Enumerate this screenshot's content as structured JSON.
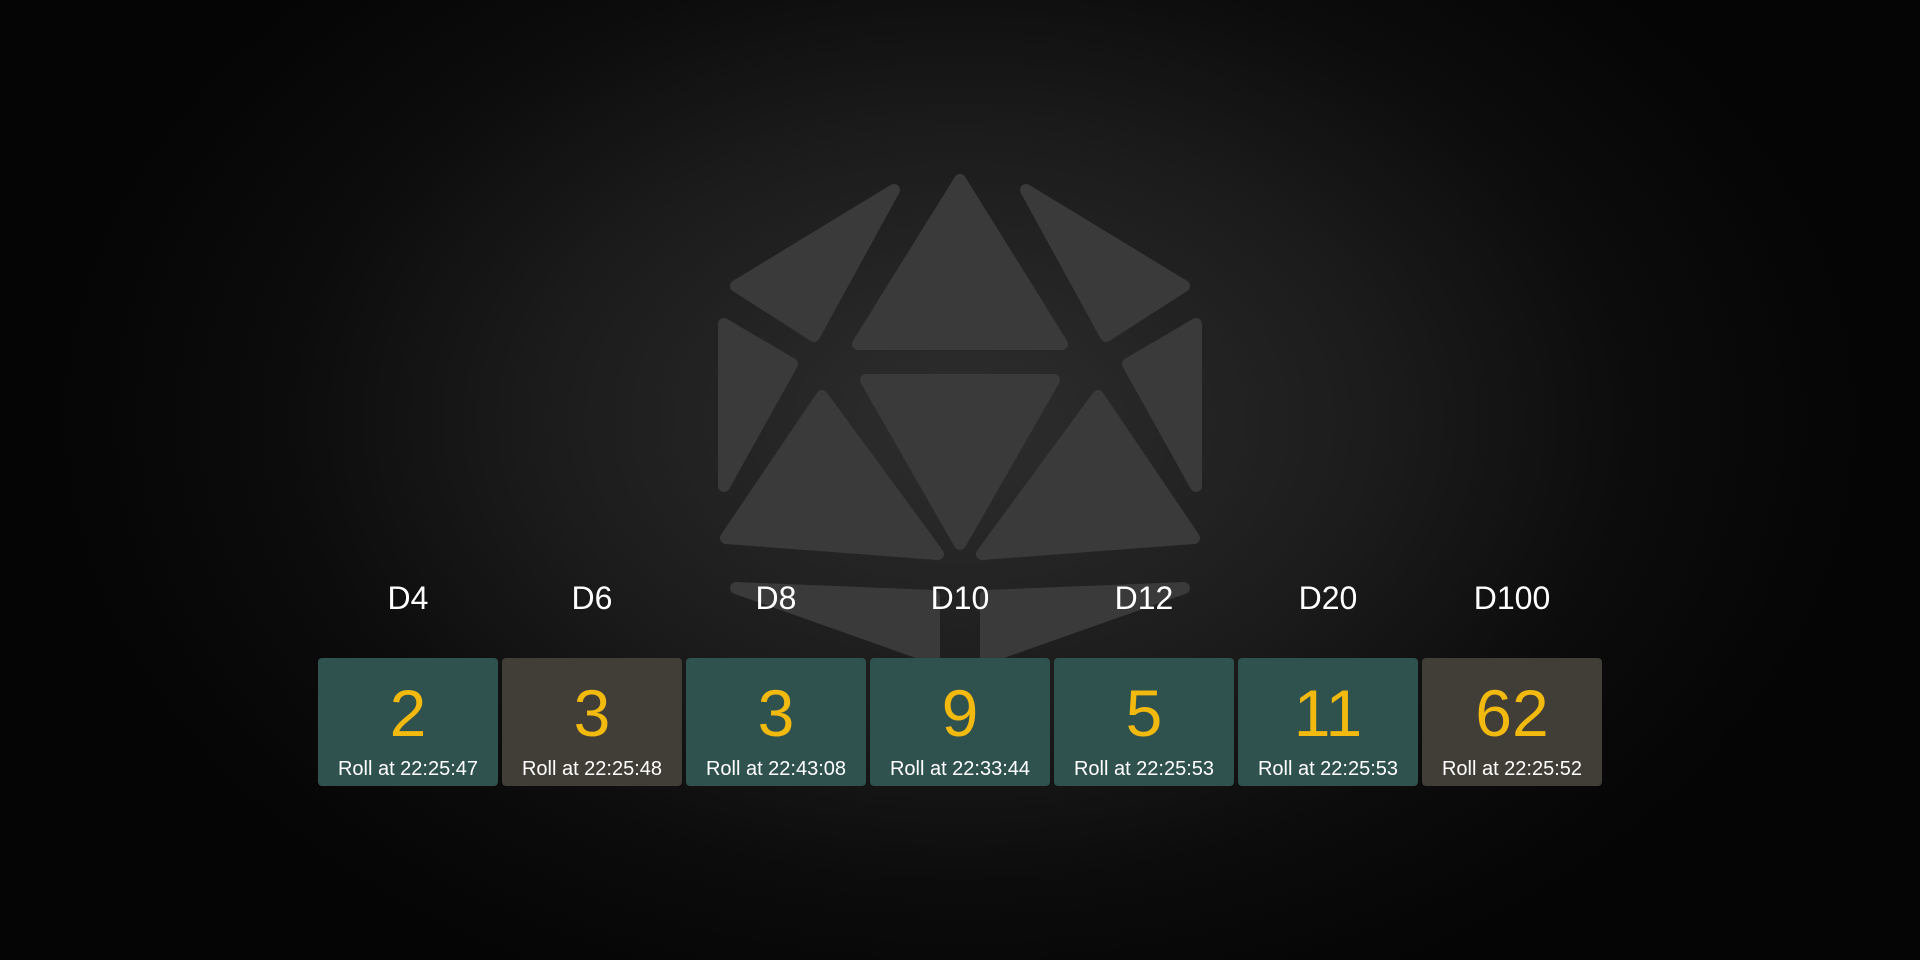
{
  "logo": {
    "icon": "d20-icon"
  },
  "colors": {
    "accent": "#f2b90f",
    "card_teal": "#30524e",
    "card_brown": "#413d37",
    "text": "#ffffff"
  },
  "dice": [
    {
      "label": "D4",
      "value": "2",
      "time": "Roll at 22:25:47",
      "color": "#30524e"
    },
    {
      "label": "D6",
      "value": "3",
      "time": "Roll at 22:25:48",
      "color": "#413d37"
    },
    {
      "label": "D8",
      "value": "3",
      "time": "Roll at 22:43:08",
      "color": "#30524e"
    },
    {
      "label": "D10",
      "value": "9",
      "time": "Roll at 22:33:44",
      "color": "#30524e"
    },
    {
      "label": "D12",
      "value": "5",
      "time": "Roll at 22:25:53",
      "color": "#30524e"
    },
    {
      "label": "D20",
      "value": "11",
      "time": "Roll at 22:25:53",
      "color": "#30524e"
    },
    {
      "label": "D100",
      "value": "62",
      "time": "Roll at 22:25:52",
      "color": "#413d37"
    }
  ]
}
